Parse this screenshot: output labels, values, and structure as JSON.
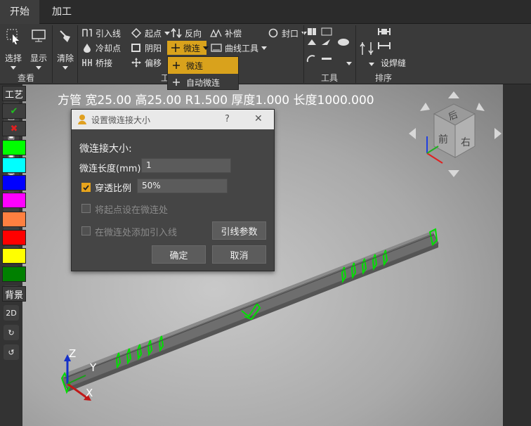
{
  "tabs": [
    {
      "label": "开始"
    },
    {
      "label": "加工"
    }
  ],
  "ribbon": {
    "groups": [
      {
        "label": "查看"
      },
      {
        "label": "工"
      },
      {
        "label": "工具"
      },
      {
        "label": "排序"
      }
    ],
    "select_label": "选择",
    "display_label": "显示",
    "clear_label": "清除",
    "lead_line_label": "引入线",
    "cooling_point_label": "冷却点",
    "bridge_label": "桥接",
    "start_point_label": "起点",
    "yin_yang_label": "阴阳",
    "offset_label": "偏移",
    "reverse_label": "反向",
    "micro_joint_label": "微连",
    "compensate_label": "补偿",
    "curve_tool_label": "曲线工具",
    "seal_label": "封口",
    "weld_seam_label": "设焊缝"
  },
  "dropdown": {
    "items": [
      {
        "label": "微连"
      },
      {
        "label": "自动微连"
      }
    ]
  },
  "info_text": "方管 宽25.00 高25.00 R1.500 厚度1.000 长度1000.000",
  "view_cube": {
    "top": "后",
    "front": "前",
    "right": "右"
  },
  "axes": {
    "x": "X",
    "y": "Y",
    "z": "Z"
  },
  "left_toolbar": {
    "mode_2d": "2D"
  },
  "right_panel": {
    "process_label": "工艺",
    "background_label": "背景",
    "colors": [
      "#00ff00",
      "#00ffff",
      "#0000ff",
      "#ff00ff",
      "#ff8040",
      "#ff0000",
      "#ffff00",
      "#008000"
    ]
  },
  "dialog": {
    "title": "设置微连接大小",
    "help": "?",
    "close": "✕",
    "heading": "微连接大小:",
    "length_label": "微连长度(mm)",
    "length_value": "1",
    "penetration_label": "穿透比例",
    "penetration_value": "50%",
    "start_at_joint_label": "将起点设在微连处",
    "add_lead_label": "在微连处添加引入线",
    "lead_params_button": "引线参数",
    "ok_button": "确定",
    "cancel_button": "取消"
  }
}
